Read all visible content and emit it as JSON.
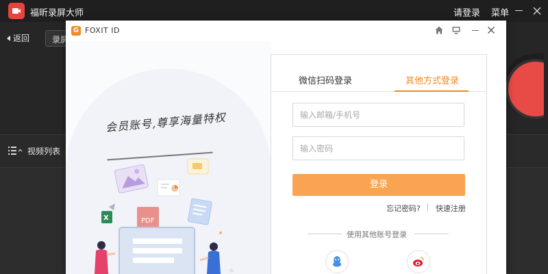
{
  "app": {
    "title": "福昕录屏大师",
    "login": "请登录",
    "menu": "菜单",
    "back": "返回",
    "tab_partial": "录屏",
    "video_list": "视频列表",
    "colors": {
      "brand": "#e8433f",
      "record": "#e84a46"
    }
  },
  "dialog": {
    "title": "FOXIT ID",
    "logo_letter": "G",
    "slogan": "会员账号,尊享海量特权",
    "illustration_badge": "PDF",
    "tabs": {
      "wechat": "微信扫码登录",
      "other": "其他方式登录"
    },
    "email_placeholder": "输入邮箱/手机号",
    "password_placeholder": "输入密码",
    "login_button": "登录",
    "forgot": "忘记密码?",
    "register": "快速注册",
    "other_accounts": "使用其他账号登录",
    "social": [
      "qq-icon",
      "weibo-icon"
    ],
    "colors": {
      "accent": "#f08a24",
      "button": "#f8a453"
    }
  }
}
